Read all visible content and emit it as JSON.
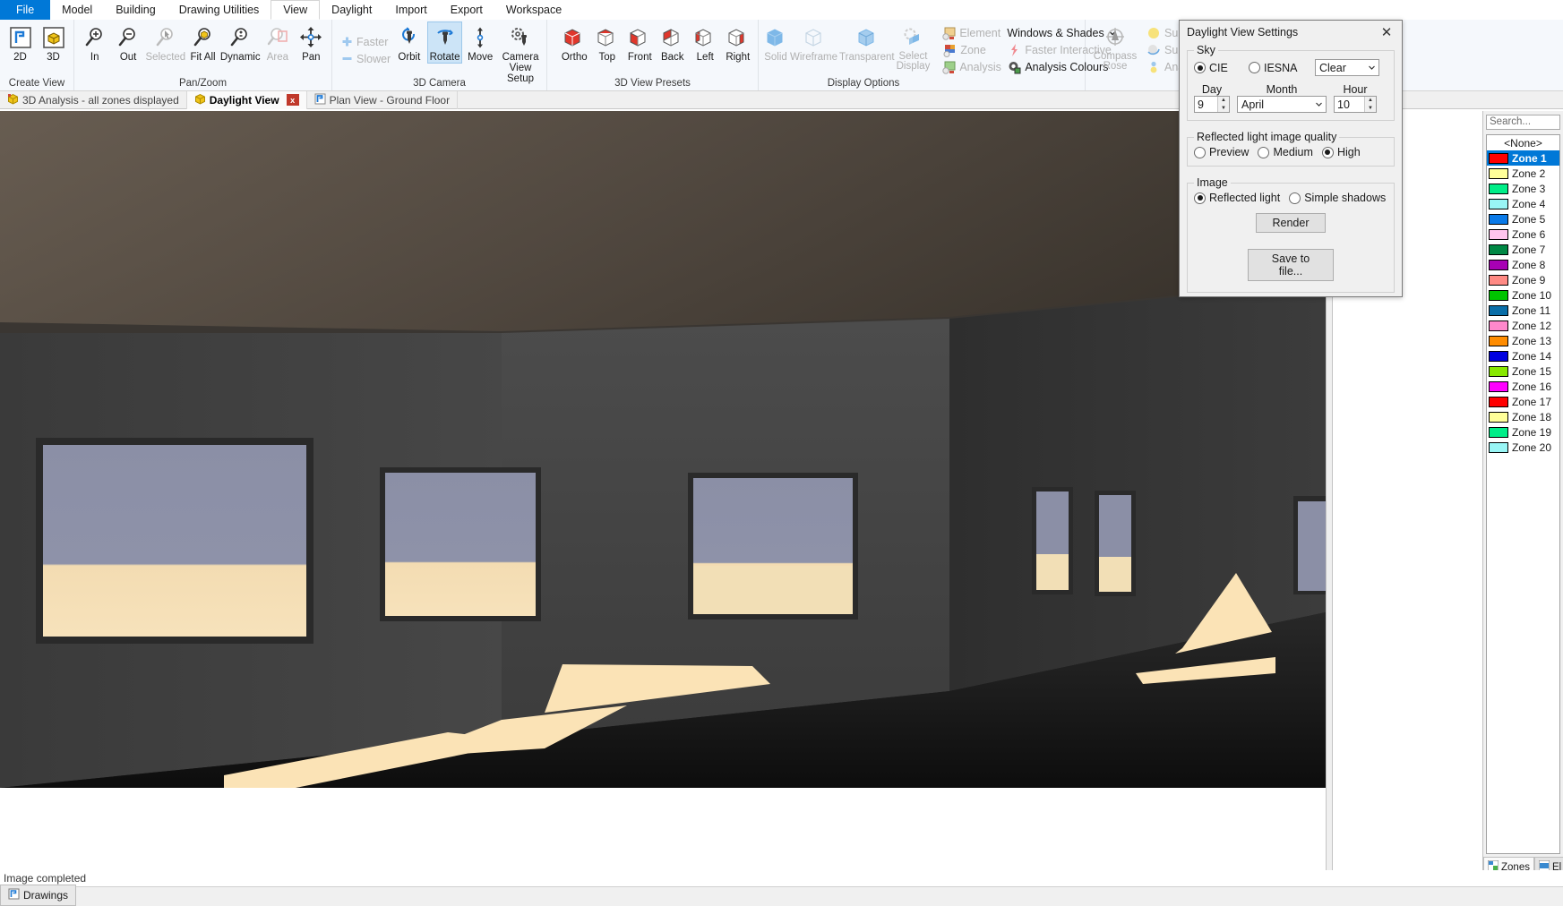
{
  "menubar": {
    "items": [
      {
        "label": "File",
        "state": "file"
      },
      {
        "label": "Model",
        "state": "normal"
      },
      {
        "label": "Building",
        "state": "normal"
      },
      {
        "label": "Drawing Utilities",
        "state": "normal"
      },
      {
        "label": "View",
        "state": "active"
      },
      {
        "label": "Daylight",
        "state": "normal"
      },
      {
        "label": "Import",
        "state": "normal"
      },
      {
        "label": "Export",
        "state": "normal"
      },
      {
        "label": "Workspace",
        "state": "normal"
      }
    ]
  },
  "ribbon": {
    "groups": [
      {
        "title": "Create View",
        "buttons": [
          {
            "label": "2D",
            "icon": "2d-view-icon",
            "state": "normal"
          },
          {
            "label": "3D",
            "icon": "3d-view-icon",
            "state": "normal"
          }
        ]
      },
      {
        "title": "Pan/Zoom",
        "buttons": [
          {
            "label": "In",
            "icon": "zoom-in-icon",
            "state": "normal"
          },
          {
            "label": "Out",
            "icon": "zoom-out-icon",
            "state": "normal"
          },
          {
            "label": "Selected",
            "icon": "zoom-selected-icon",
            "state": "disabled"
          },
          {
            "label": "Fit All",
            "icon": "zoom-fit-all-icon",
            "state": "normal"
          },
          {
            "label": "Dynamic",
            "icon": "zoom-dynamic-icon",
            "state": "normal"
          },
          {
            "label": "Area",
            "icon": "zoom-area-icon",
            "state": "disabled"
          },
          {
            "label": "Pan",
            "icon": "pan-icon",
            "state": "normal"
          }
        ]
      },
      {
        "title": "3D Camera",
        "speed": [
          {
            "label": "Faster",
            "icon": "plus-icon",
            "state": "disabled"
          },
          {
            "label": "Slower",
            "icon": "minus-icon",
            "state": "disabled"
          }
        ],
        "buttons": [
          {
            "label": "Orbit",
            "icon": "orbit-icon",
            "state": "normal"
          },
          {
            "label": "Rotate",
            "icon": "rotate-icon",
            "state": "selected"
          },
          {
            "label": "Move",
            "icon": "move-icon",
            "state": "normal"
          },
          {
            "label": "Camera View Setup",
            "icon": "camera-view-setup-icon",
            "state": "normal"
          }
        ]
      },
      {
        "title": "3D View Presets",
        "buttons": [
          {
            "label": "Ortho",
            "icon": "cube-ortho-icon",
            "state": "normal"
          },
          {
            "label": "Top",
            "icon": "cube-top-icon",
            "state": "normal"
          },
          {
            "label": "Front",
            "icon": "cube-front-icon",
            "state": "normal"
          },
          {
            "label": "Back",
            "icon": "cube-back-icon",
            "state": "normal"
          },
          {
            "label": "Left",
            "icon": "cube-left-icon",
            "state": "normal"
          },
          {
            "label": "Right",
            "icon": "cube-right-icon",
            "state": "normal"
          }
        ]
      },
      {
        "title": "Display Options",
        "buttons": [
          {
            "label": "Solid",
            "icon": "cube-solid-icon",
            "state": "disabled"
          },
          {
            "label": "Wireframe",
            "icon": "cube-wireframe-icon",
            "state": "disabled"
          },
          {
            "label": "Transparent",
            "icon": "cube-transparent-icon",
            "state": "disabled"
          },
          {
            "label": "Select Display",
            "icon": "select-display-icon",
            "state": "disabled"
          }
        ],
        "colA": [
          {
            "label": "Element",
            "icon": "element-icon",
            "state": "disabled"
          },
          {
            "label": "Zone",
            "icon": "zone-icon",
            "state": "disabled"
          },
          {
            "label": "Analysis",
            "icon": "analysis-icon",
            "state": "disabled"
          }
        ],
        "colB": [
          {
            "label": "Windows & Shades",
            "icon": "chevron-down-icon",
            "state": "normal"
          },
          {
            "label": "Faster Interactive",
            "icon": "lightning-icon",
            "state": "disabled"
          },
          {
            "label": "Analysis Colours",
            "icon": "analysis-colours-icon",
            "state": "normal"
          }
        ]
      },
      {
        "title": "",
        "buttons": [
          {
            "label": "Compass Rose",
            "icon": "compass-rose-icon",
            "state": "disabled"
          }
        ],
        "colA": [
          {
            "label": "Sun",
            "icon": "sun-icon",
            "state": "disabled"
          },
          {
            "label": "Sun An",
            "icon": "sun-analysis-icon",
            "state": "disabled"
          },
          {
            "label": "Analem",
            "icon": "analemma-icon",
            "state": "disabled"
          }
        ]
      }
    ]
  },
  "viewtabs": {
    "items": [
      {
        "label": "3D Analysis - all zones displayed",
        "icon": "cube-yellow-icon",
        "active": false,
        "closable": false
      },
      {
        "label": "Daylight View",
        "icon": "cube-yellow-icon",
        "active": true,
        "closable": true,
        "close_label": "x"
      },
      {
        "label": "Plan View - Ground Floor",
        "icon": "plan-view-icon",
        "active": false,
        "closable": false
      }
    ]
  },
  "dialog": {
    "title": "Daylight View Settings",
    "close_icon": "close-icon",
    "sky": {
      "legend": "Sky",
      "options": [
        {
          "label": "CIE",
          "selected": true
        },
        {
          "label": "IESNA",
          "selected": false
        }
      ],
      "sky_type": "Clear",
      "day_label": "Day",
      "day_value": "9",
      "month_label": "Month",
      "month_value": "April",
      "hour_label": "Hour",
      "hour_value": "10"
    },
    "quality": {
      "legend": "Reflected light image quality",
      "options": [
        {
          "label": "Preview",
          "selected": false
        },
        {
          "label": "Medium",
          "selected": false
        },
        {
          "label": "High",
          "selected": true
        }
      ]
    },
    "image": {
      "legend": "Image",
      "options": [
        {
          "label": "Reflected light",
          "selected": true
        },
        {
          "label": "Simple shadows",
          "selected": false
        }
      ],
      "render_label": "Render",
      "save_label": "Save to file..."
    }
  },
  "zonepanel": {
    "search_placeholder": "Search...",
    "none_label": "<None>",
    "zones": [
      {
        "label": "Zone 1",
        "color": "#ff0000",
        "selected": true
      },
      {
        "label": "Zone 2",
        "color": "#ffff99",
        "selected": false
      },
      {
        "label": "Zone 3",
        "color": "#00ee88",
        "selected": false
      },
      {
        "label": "Zone 4",
        "color": "#99f5f5",
        "selected": false
      },
      {
        "label": "Zone 5",
        "color": "#0a7ae8",
        "selected": false
      },
      {
        "label": "Zone 6",
        "color": "#ffc4ee",
        "selected": false
      },
      {
        "label": "Zone 7",
        "color": "#008844",
        "selected": false
      },
      {
        "label": "Zone 8",
        "color": "#a800b4",
        "selected": false
      },
      {
        "label": "Zone 9",
        "color": "#ff8a84",
        "selected": false
      },
      {
        "label": "Zone 10",
        "color": "#00c400",
        "selected": false
      },
      {
        "label": "Zone 11",
        "color": "#0a6ea8",
        "selected": false
      },
      {
        "label": "Zone 12",
        "color": "#ff88cc",
        "selected": false
      },
      {
        "label": "Zone 13",
        "color": "#ff8c00",
        "selected": false
      },
      {
        "label": "Zone 14",
        "color": "#0000e0",
        "selected": false
      },
      {
        "label": "Zone 15",
        "color": "#88e800",
        "selected": false
      },
      {
        "label": "Zone 16",
        "color": "#ff00ff",
        "selected": false
      },
      {
        "label": "Zone 17",
        "color": "#ff0000",
        "selected": false
      },
      {
        "label": "Zone 18",
        "color": "#ffff99",
        "selected": false
      },
      {
        "label": "Zone 19",
        "color": "#00ee88",
        "selected": false
      },
      {
        "label": "Zone 20",
        "color": "#99f5f5",
        "selected": false
      }
    ],
    "tabs": [
      {
        "label": "Zones",
        "icon": "zones-tab-icon",
        "active": true
      },
      {
        "label": "El",
        "icon": "elements-tab-icon",
        "active": false
      }
    ]
  },
  "statusbar": {
    "message": "Image completed"
  },
  "taskbar": {
    "tabs": [
      {
        "label": "Drawings",
        "icon": "drawings-icon"
      }
    ]
  },
  "colors": {
    "accent": "#0078d7",
    "ribbon_bg": "#f5f8fc",
    "selected_zone": "#0078d7",
    "render_wall": "#4a4a4a",
    "render_sunlight": "#ffe4b5",
    "render_glass": "#8b8fa8"
  }
}
